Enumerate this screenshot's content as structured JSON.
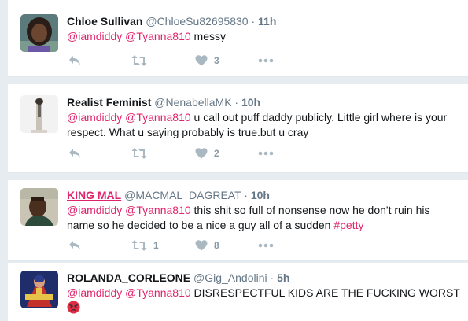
{
  "colors": {
    "accent": "#e0246b",
    "muted": "#657786",
    "icon": "#aab8c2",
    "background": "#e6ecf0"
  },
  "tweets": [
    {
      "name": "Chloe Sullivan",
      "handle": "@ChloeSu82695830",
      "separator": "·",
      "time": "11h",
      "mentions": [
        "@iamdiddy",
        "@Tyanna810"
      ],
      "text": "messy",
      "reply_count": "",
      "retweet_count": "",
      "like_count": "3",
      "icons": [
        "reply-icon",
        "retweet-icon",
        "heart-icon",
        "more-icon"
      ]
    },
    {
      "name": "Realist Feminist",
      "handle": "@NenabellaMK",
      "separator": "·",
      "time": "10h",
      "mentions": [
        "@iamdiddy",
        "@Tyanna810"
      ],
      "text": "u call out puff daddy publicly. Little girl where is your respect.  What u saying probably is true.but u cray",
      "reply_count": "",
      "retweet_count": "",
      "like_count": "2",
      "icons": [
        "reply-icon",
        "retweet-icon",
        "heart-icon",
        "more-icon"
      ]
    },
    {
      "name": "KING MAL",
      "handle": "@MACMAL_DAGREAT",
      "separator": "·",
      "time": "10h",
      "mentions": [
        "@iamdiddy",
        "@Tyanna810"
      ],
      "text": "this shit so full of nonsense now he don't ruin his name so he decided to be a nice a guy all of a sudden",
      "hashtag": "#petty",
      "reply_count": "",
      "retweet_count": "1",
      "like_count": "8",
      "icons": [
        "reply-icon",
        "retweet-icon",
        "heart-icon",
        "more-icon"
      ]
    },
    {
      "name": "ROLANDA_CORLEONE",
      "handle": "@Gig_Andolini",
      "separator": "·",
      "time": "5h",
      "mentions": [
        "@iamdiddy",
        "@Tyanna810"
      ],
      "text": "DISRESPECTFUL KIDS ARE THE FUCKING WORST",
      "emoji": "angry-face-icon",
      "icons": [
        "reply-icon",
        "retweet-icon",
        "heart-icon",
        "more-icon"
      ]
    }
  ]
}
